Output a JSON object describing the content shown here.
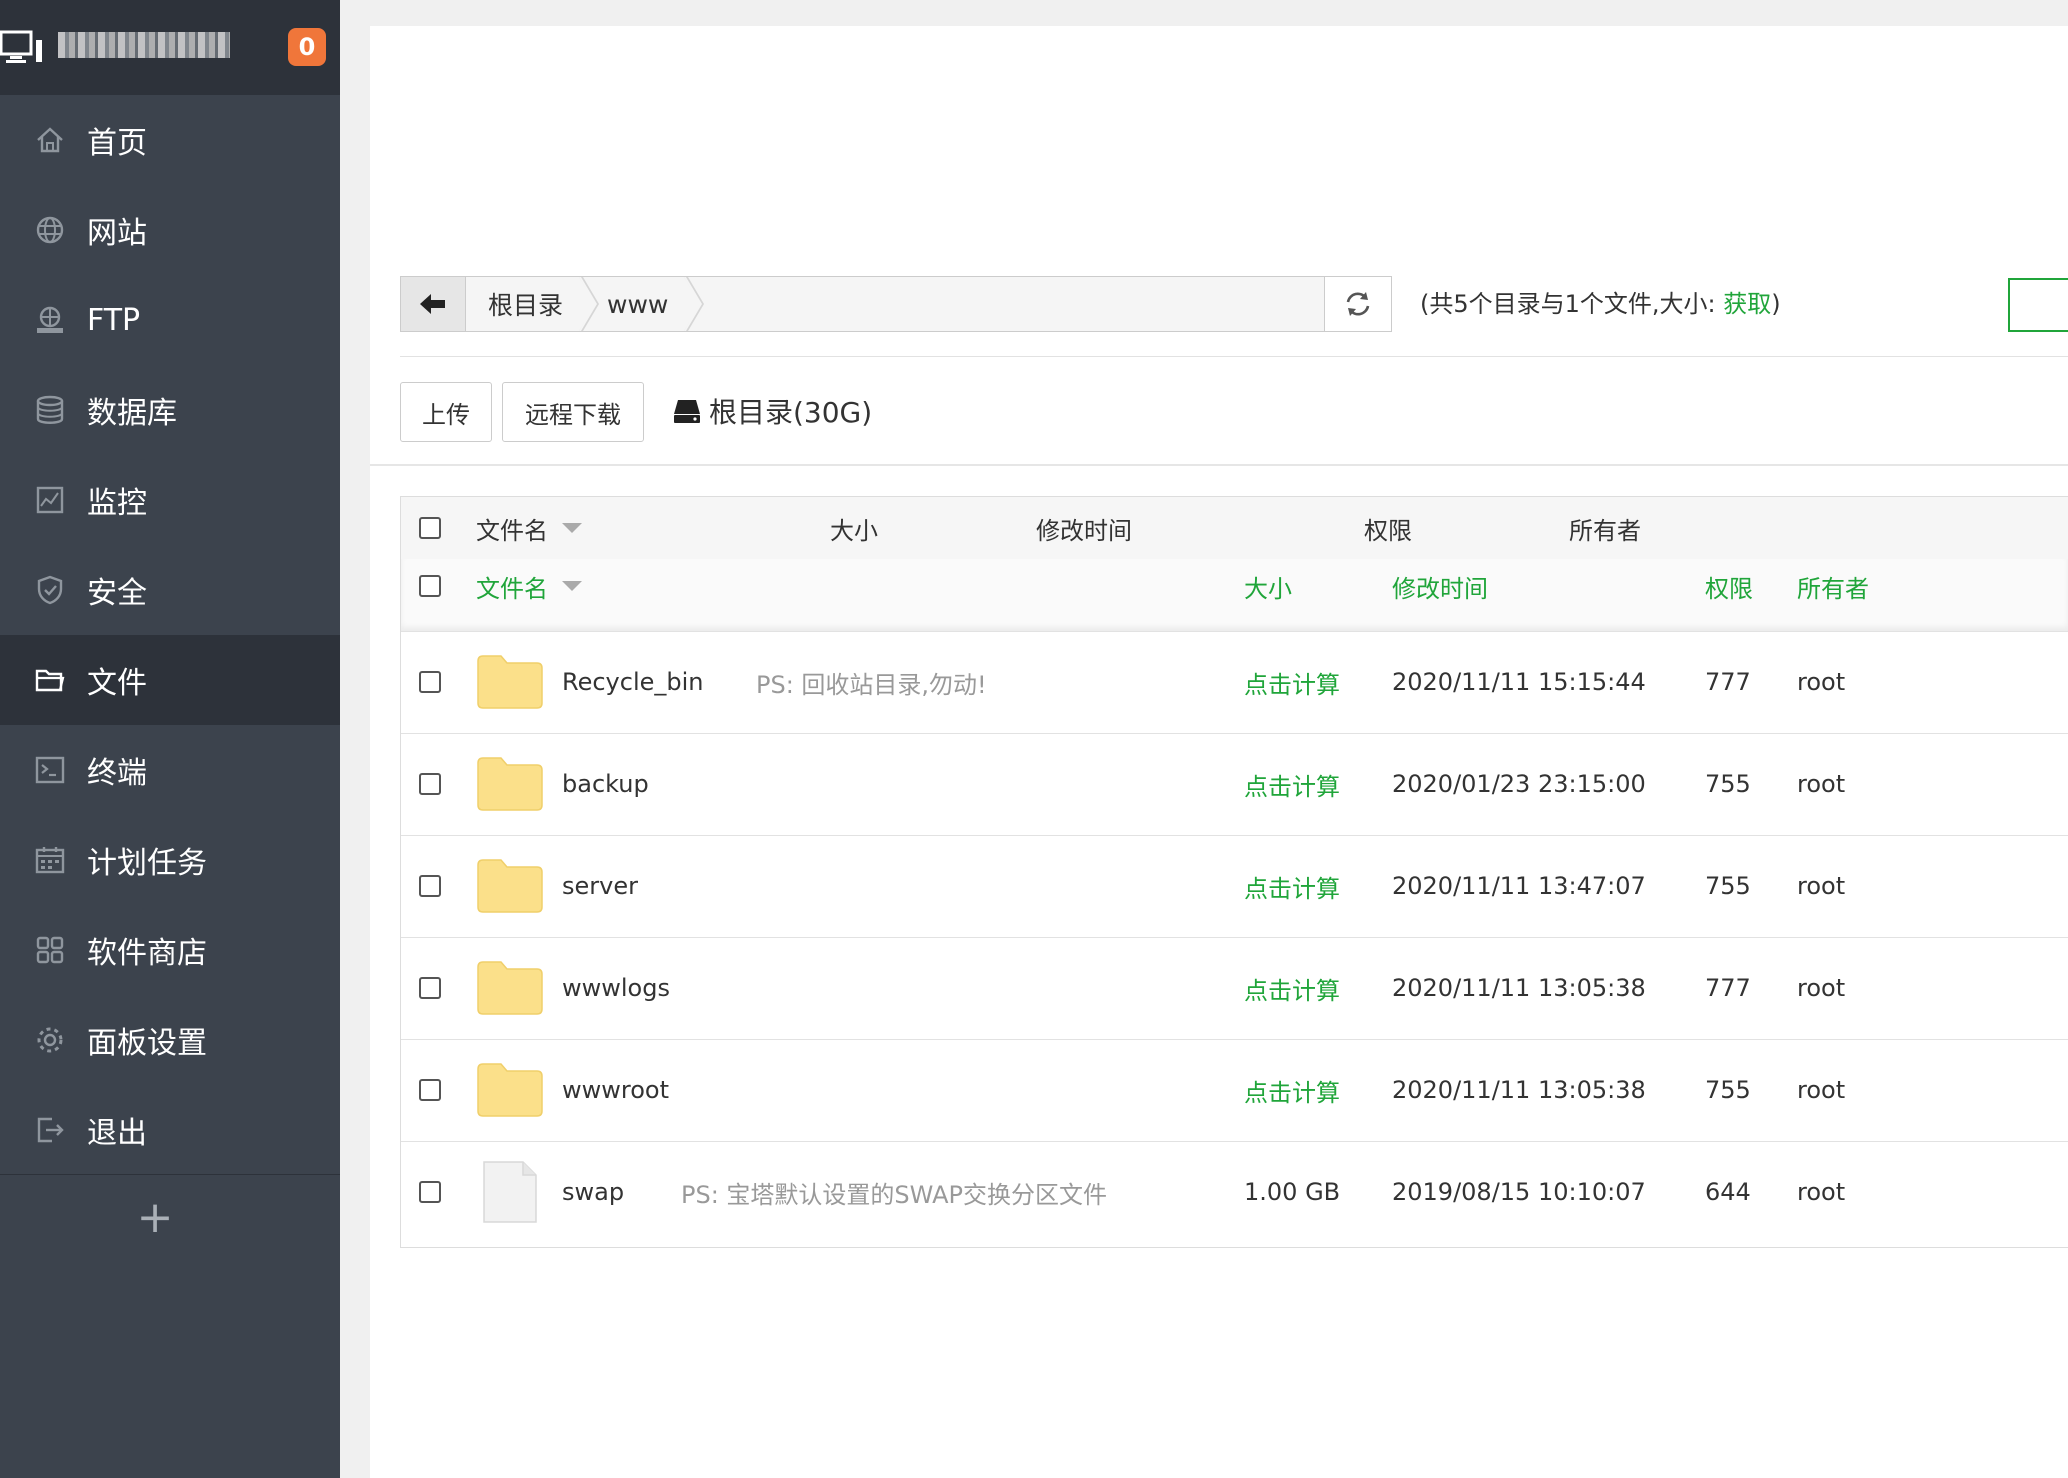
{
  "sidebar": {
    "badge": "0",
    "items": [
      {
        "label": "首页",
        "icon": "home-icon"
      },
      {
        "label": "网站",
        "icon": "globe-icon"
      },
      {
        "label": "FTP",
        "icon": "ftp-icon"
      },
      {
        "label": "数据库",
        "icon": "database-icon"
      },
      {
        "label": "监控",
        "icon": "monitor-chart-icon"
      },
      {
        "label": "安全",
        "icon": "shield-icon"
      },
      {
        "label": "文件",
        "icon": "folder-icon",
        "active": true
      },
      {
        "label": "终端",
        "icon": "terminal-icon"
      },
      {
        "label": "计划任务",
        "icon": "calendar-icon"
      },
      {
        "label": "软件商店",
        "icon": "grid-icon"
      },
      {
        "label": "面板设置",
        "icon": "gear-icon"
      },
      {
        "label": "退出",
        "icon": "logout-icon"
      }
    ],
    "add_label": "+"
  },
  "path": {
    "crumbs": [
      "根目录",
      "www"
    ]
  },
  "summary": {
    "prefix": "(共5个目录与1个文件,大小: ",
    "fetch": "获取",
    "suffix": ")"
  },
  "actions": {
    "upload": "上传",
    "remote_download": "远程下载",
    "disk": "根目录(30G)"
  },
  "table": {
    "header_top": {
      "name": "文件名",
      "size": "大小",
      "mtime": "修改时间",
      "perm": "权限",
      "owner": "所有者"
    },
    "header": {
      "name": "文件名",
      "size": "大小",
      "mtime": "修改时间",
      "perm": "权限",
      "owner": "所有者"
    },
    "rows": [
      {
        "type": "folder",
        "name": "Recycle_bin",
        "note": "PS: 回收站目录,勿动!",
        "size": "点击计算",
        "mtime": "2020/11/11 15:15:44",
        "perm": "777",
        "owner": "root"
      },
      {
        "type": "folder",
        "name": "backup",
        "note": "",
        "size": "点击计算",
        "mtime": "2020/01/23 23:15:00",
        "perm": "755",
        "owner": "root"
      },
      {
        "type": "folder",
        "name": "server",
        "note": "",
        "size": "点击计算",
        "mtime": "2020/11/11 13:47:07",
        "perm": "755",
        "owner": "root"
      },
      {
        "type": "folder",
        "name": "wwwlogs",
        "note": "",
        "size": "点击计算",
        "mtime": "2020/11/11 13:05:38",
        "perm": "777",
        "owner": "root"
      },
      {
        "type": "folder",
        "name": "wwwroot",
        "note": "",
        "size": "点击计算",
        "mtime": "2020/11/11 13:05:38",
        "perm": "755",
        "owner": "root"
      },
      {
        "type": "file",
        "name": "swap",
        "note": "PS: 宝塔默认设置的SWAP交换分区文件",
        "size": "1.00 GB",
        "mtime": "2019/08/15 10:10:07",
        "perm": "644",
        "owner": "root"
      }
    ]
  },
  "colors": {
    "accent": "#20a53a",
    "sidebar": "#3c434d",
    "sidebar_dark": "#2d323a",
    "badge": "#f0763a",
    "folder": "#fbe08a"
  }
}
